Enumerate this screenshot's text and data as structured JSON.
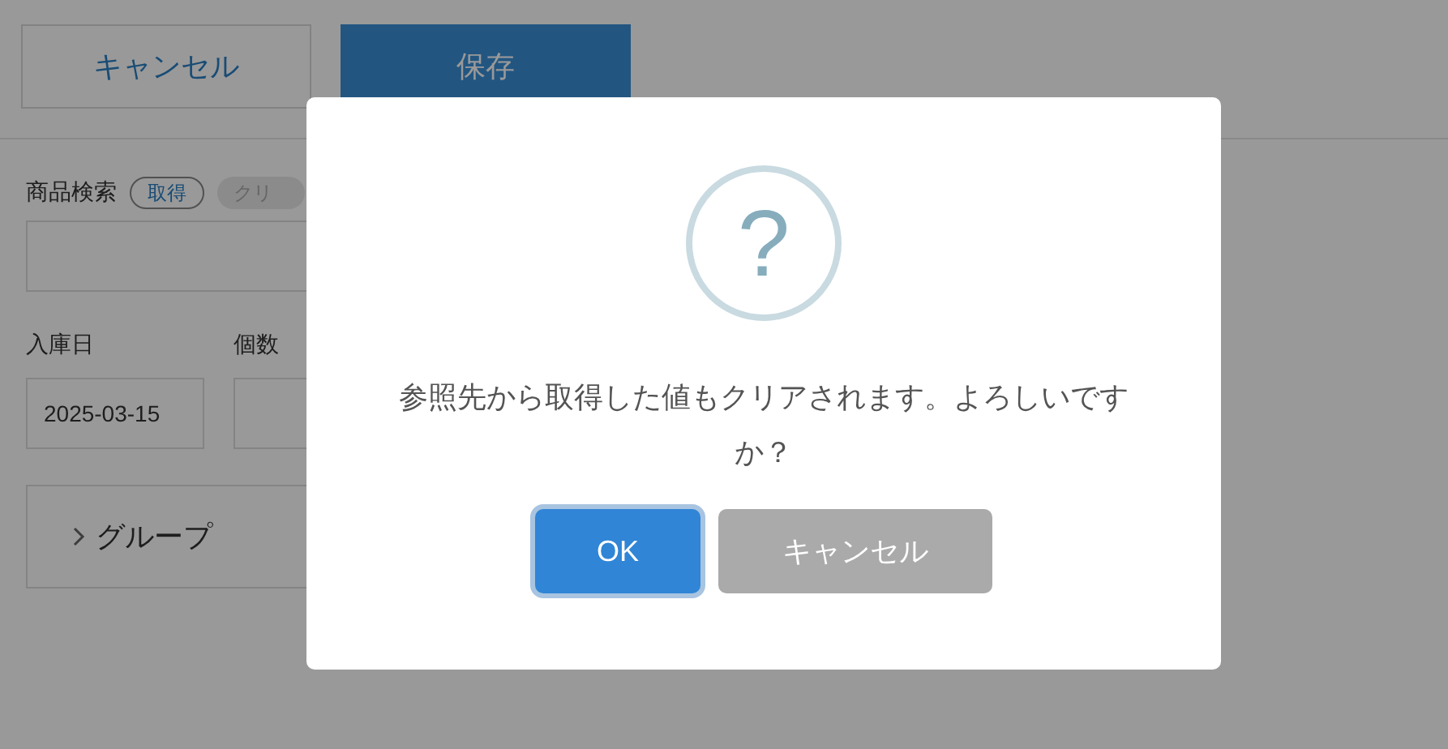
{
  "header_buttons": [
    {
      "label": "キャンセル",
      "kind": "outline"
    },
    {
      "label": "保存",
      "kind": "primary"
    }
  ],
  "product_search": {
    "label": "商品検索",
    "get_button": "取得",
    "clear_button": "クリ"
  },
  "fields": [
    {
      "label": "入庫日",
      "value": "2025-03-15"
    },
    {
      "label": "個数"
    }
  ],
  "group": {
    "label": "グループ",
    "expanded": false
  },
  "dialog": {
    "icon": "?",
    "message": "参照先から取得した値もクリアされます。よろしいですか？",
    "buttons": [
      {
        "label": "OK",
        "kind": "confirm",
        "focused": true
      },
      {
        "label": "キャンセル",
        "kind": "cancel",
        "focused": false
      }
    ]
  }
}
